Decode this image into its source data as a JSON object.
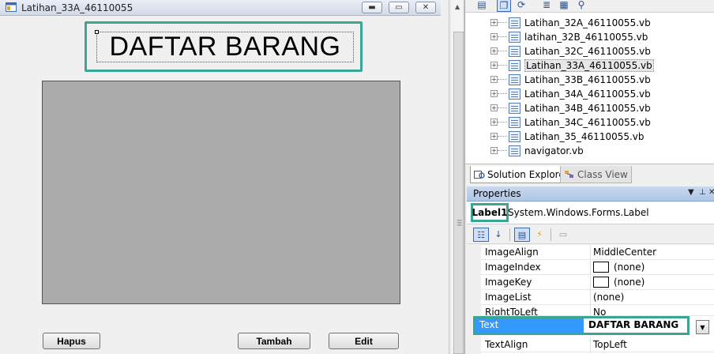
{
  "designer": {
    "form_title": "Latihan_33A_46110055",
    "label_text": "DAFTAR BARANG",
    "buttons": {
      "hapus": "Hapus",
      "tambah": "Tambah",
      "edit": "Edit"
    }
  },
  "solution_explorer": {
    "items": [
      "Latihan_32A_46110055.vb",
      "latihan_32B_46110055.vb",
      "Latihan_32C_46110055.vb",
      "Latihan_33A_46110055.vb",
      "Latihan_33B_46110055.vb",
      "Latihan_34A_46110055.vb",
      "Latihan_34B_46110055.vb",
      "Latihan_34C_46110055.vb",
      "Latihan_35_46110055.vb",
      "navigator.vb"
    ],
    "selected_index": 3,
    "tabs": {
      "solution": "Solution Explorer",
      "class": "Class View"
    }
  },
  "properties": {
    "title": "Properties",
    "object_name": "Label1",
    "object_type": "System.Windows.Forms.Label",
    "rows": {
      "image_align": {
        "name": "ImageAlign",
        "value": "MiddleCenter"
      },
      "image_index": {
        "name": "ImageIndex",
        "value": "(none)"
      },
      "image_key": {
        "name": "ImageKey",
        "value": "(none)"
      },
      "image_list": {
        "name": "ImageList",
        "value": "(none)"
      },
      "right_to_left": {
        "name": "RightToLeft",
        "value": "No"
      },
      "text": {
        "name": "Text",
        "value": "DAFTAR BARANG"
      },
      "text_align": {
        "name": "TextAlign",
        "value": "TopLeft"
      }
    }
  },
  "colors": {
    "highlight_border": "#3aa593",
    "selection_blue": "#3399ff",
    "datagrid_fill": "#ababab"
  }
}
